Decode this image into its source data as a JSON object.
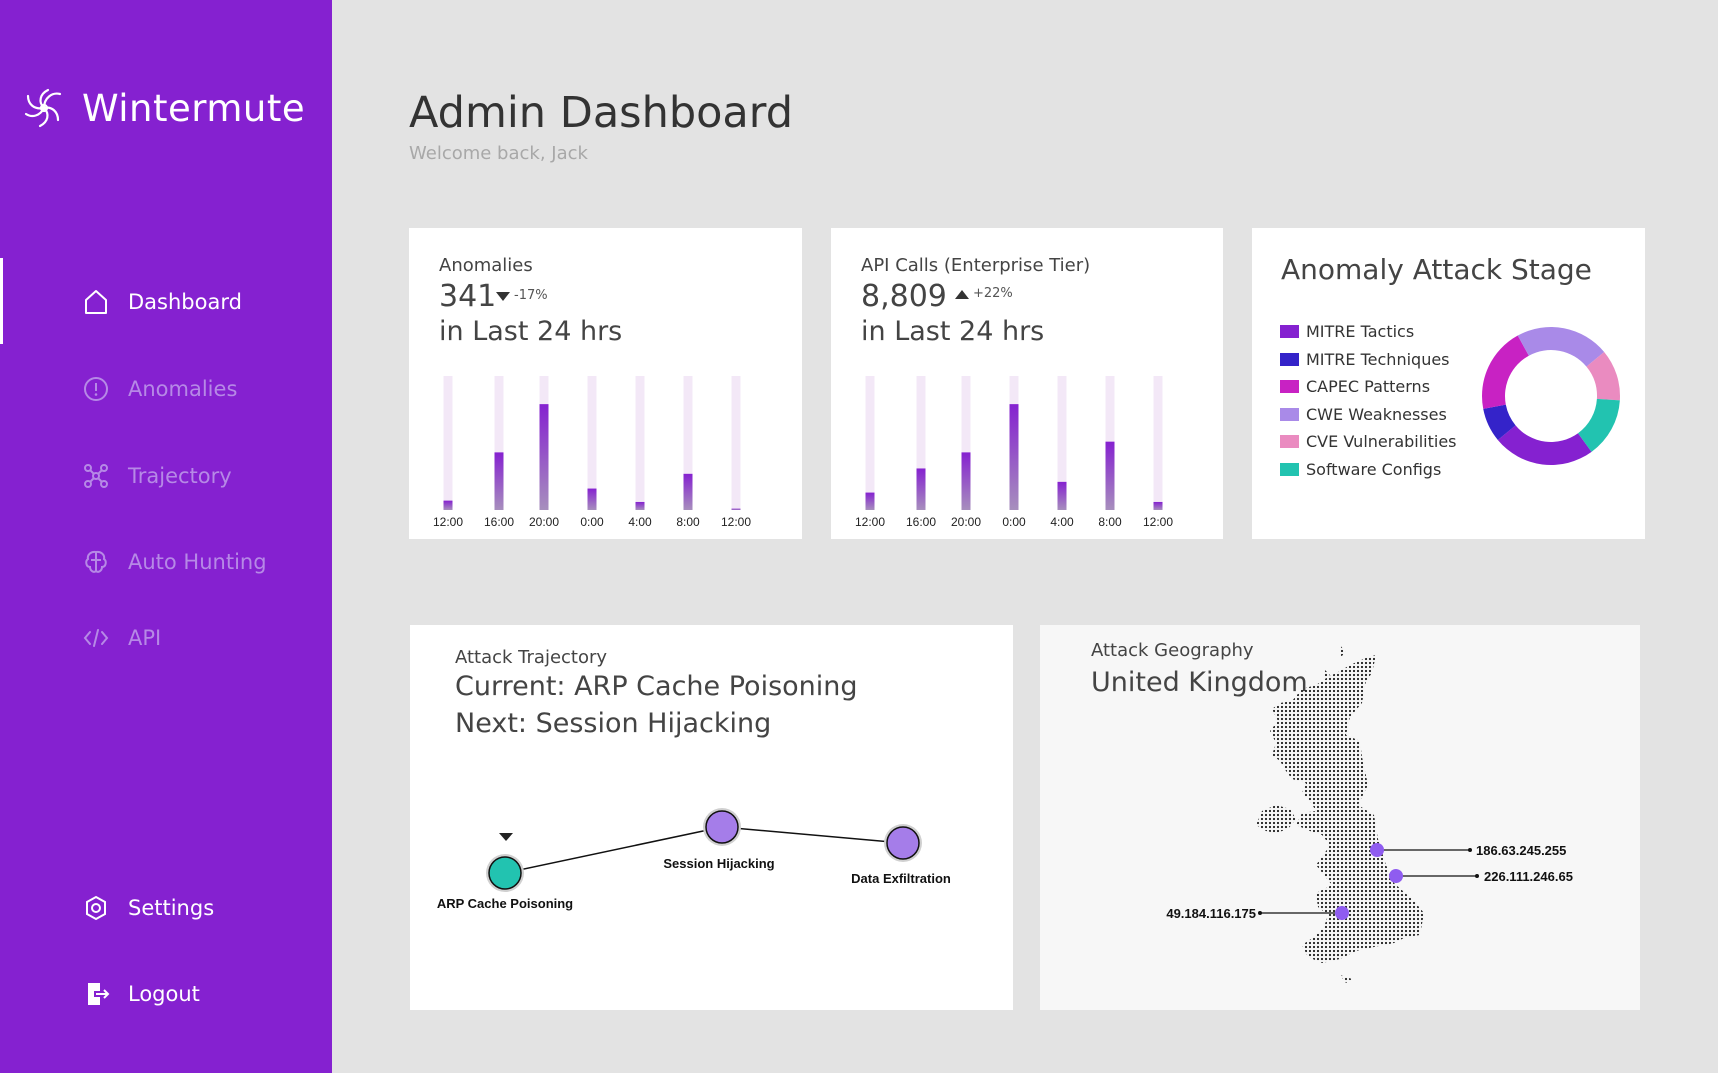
{
  "app": {
    "name": "Wintermute"
  },
  "nav": {
    "items": [
      {
        "label": "Dashboard",
        "icon": "home-icon",
        "active": true
      },
      {
        "label": "Anomalies",
        "icon": "alert-circle-icon"
      },
      {
        "label": "Trajectory",
        "icon": "network-icon"
      },
      {
        "label": "Auto Hunting",
        "icon": "brain-icon"
      },
      {
        "label": "API",
        "icon": "code-icon"
      }
    ],
    "bottom": [
      {
        "label": "Settings",
        "icon": "gear-icon"
      },
      {
        "label": "Logout",
        "icon": "logout-icon"
      }
    ]
  },
  "header": {
    "title": "Admin Dashboard",
    "subtitle": "Welcome back, Jack"
  },
  "anomalies": {
    "label": "Anomalies",
    "value": "341",
    "delta": "-17%",
    "direction": "down",
    "period": "in Last 24 hrs"
  },
  "api_calls": {
    "label": "API Calls (Enterprise Tier)",
    "value": "8,809",
    "delta": "+22%",
    "direction": "up",
    "period": "in Last 24 hrs"
  },
  "attack_stage": {
    "title": "Anomaly Attack Stage",
    "legend": [
      "MITRE Tactics",
      "MITRE Techniques",
      "CAPEC Patterns",
      "CWE Weaknesses",
      "CVE Vulnerabilities",
      "Software Configs"
    ]
  },
  "trajectory": {
    "label": "Attack Trajectory",
    "current": "Current: ARP Cache Poisoning",
    "next": "Next: Session Hijacking",
    "nodes": [
      "ARP Cache Poisoning",
      "Session Hijacking",
      "Data Exfiltration"
    ]
  },
  "geography": {
    "label": "Attack Geography",
    "country": "United Kingdom",
    "ips": [
      "186.63.245.255",
      "226.111.246.65",
      "49.184.116.175"
    ]
  },
  "colors": {
    "sidebar": "#8521d0",
    "accent": "#8521d0",
    "bar_track": "#f3e8f7",
    "node_teal": "#22c3b0",
    "node_purple": "#a57de9"
  },
  "chart_data": [
    {
      "type": "bar",
      "title": "Anomalies",
      "categories": [
        "12:00",
        "16:00",
        "20:00",
        "0:00",
        "4:00",
        "8:00",
        "12:00"
      ],
      "values": [
        7,
        43,
        79,
        16,
        6,
        27,
        1
      ],
      "ylim": [
        0,
        100
      ],
      "grid": false
    },
    {
      "type": "bar",
      "title": "API Calls (Enterprise Tier)",
      "categories": [
        "12:00",
        "16:00",
        "20:00",
        "0:00",
        "4:00",
        "8:00",
        "12:00"
      ],
      "values": [
        13,
        31,
        43,
        79,
        21,
        51,
        6
      ],
      "ylim": [
        0,
        100
      ],
      "grid": false
    },
    {
      "type": "pie",
      "title": "Anomaly Attack Stage",
      "categories": [
        "MITRE Tactics",
        "MITRE Techniques",
        "CAPEC Patterns",
        "CWE Weaknesses",
        "CVE Vulnerabilities",
        "Software Configs"
      ],
      "values": [
        24,
        8,
        20,
        22,
        12,
        14
      ],
      "colors": [
        "#8521d0",
        "#3423c9",
        "#c822c3",
        "#a98ae8",
        "#ea8bc0",
        "#22c3b0"
      ]
    }
  ]
}
